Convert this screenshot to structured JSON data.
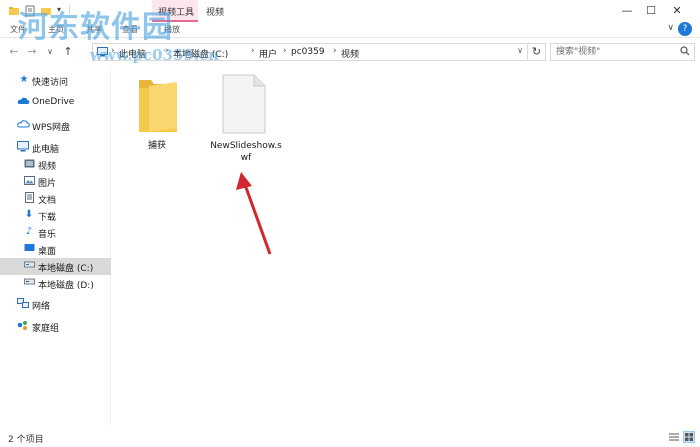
{
  "window": {
    "tool_tab": "视频工具",
    "title": "视频",
    "controls": {
      "minimize": "—",
      "maximize": "☐",
      "close": "✕"
    }
  },
  "ribbon": {
    "items": [
      "文件",
      "主页",
      "共享",
      "查看",
      "播放"
    ],
    "expand": "∨",
    "help": "?"
  },
  "address": {
    "back": "←",
    "forward": "→",
    "recent": "∨",
    "up": "↑",
    "crumbs": [
      "此电脑",
      "本地磁盘 (C:)",
      "用户",
      "pc0359",
      "视频"
    ],
    "dropdown": "∨",
    "refresh": "↻"
  },
  "search": {
    "placeholder": "搜索\"视频\""
  },
  "sidebar": {
    "items": [
      {
        "label": "快速访问",
        "icon": "star-icon"
      },
      {
        "label": "OneDrive",
        "icon": "cloud-icon"
      },
      {
        "label": "WPS网盘",
        "icon": "cloud-outline-icon"
      },
      {
        "label": "此电脑",
        "icon": "computer-icon"
      },
      {
        "label": "视频",
        "icon": "video-folder-icon"
      },
      {
        "label": "图片",
        "icon": "pictures-folder-icon"
      },
      {
        "label": "文档",
        "icon": "documents-folder-icon"
      },
      {
        "label": "下载",
        "icon": "download-icon"
      },
      {
        "label": "音乐",
        "icon": "music-icon"
      },
      {
        "label": "桌面",
        "icon": "desktop-icon"
      },
      {
        "label": "本地磁盘 (C:)",
        "icon": "drive-icon",
        "selected": true
      },
      {
        "label": "本地磁盘 (D:)",
        "icon": "drive-icon"
      },
      {
        "label": "网络",
        "icon": "network-icon"
      },
      {
        "label": "家庭组",
        "icon": "homegroup-icon"
      }
    ]
  },
  "files": [
    {
      "name": "捕获",
      "type": "folder"
    },
    {
      "name": "NewSlideshow.s\nwf",
      "type": "file"
    }
  ],
  "status": {
    "count": "2 个项目"
  },
  "watermark": {
    "title": "河东软件园",
    "url": "www.pc0359.cn"
  },
  "colors": {
    "accent": "#1e78d7",
    "tool_tab": "#fde7ef",
    "selection": "#d9d9d9",
    "arrow": "#d0282e",
    "folder": "#f6c94e"
  }
}
